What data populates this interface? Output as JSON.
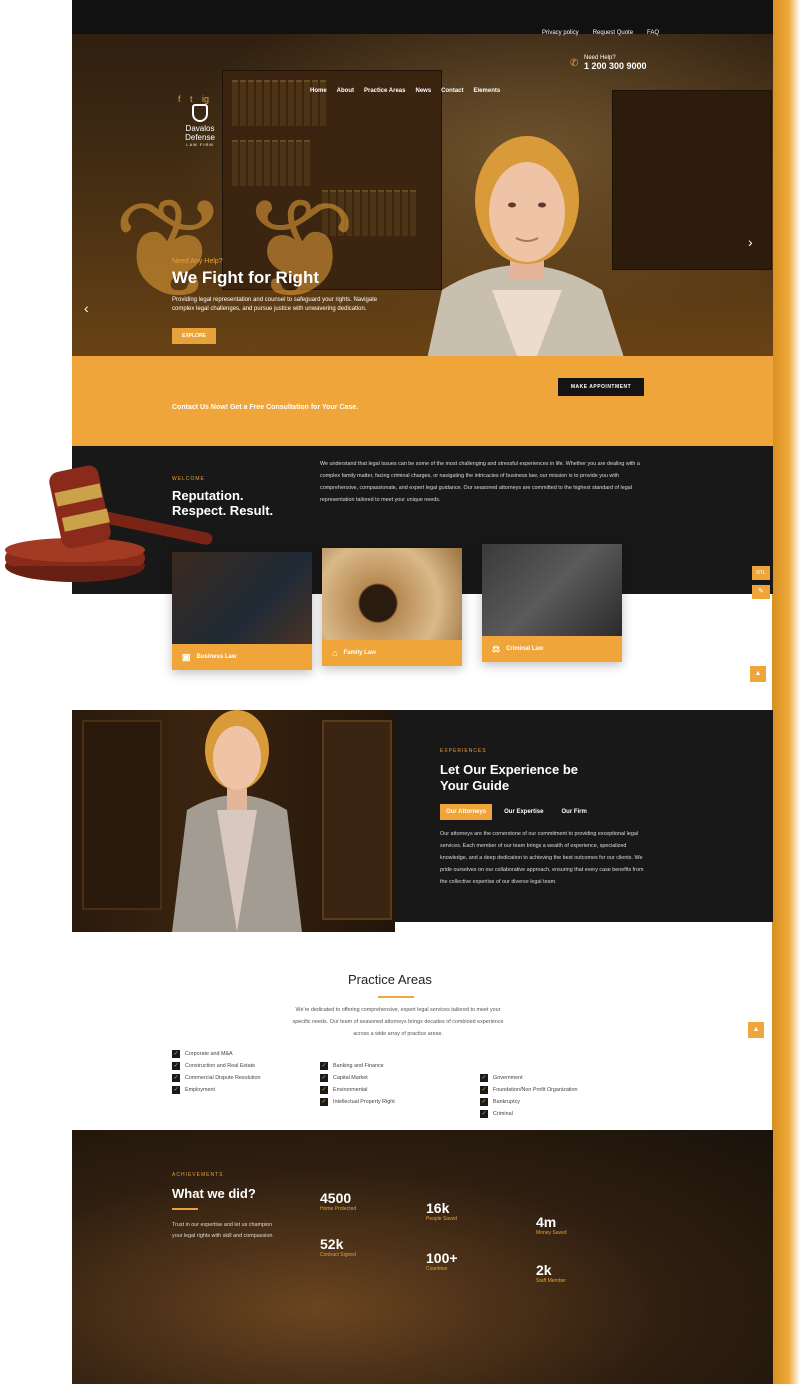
{
  "colors": {
    "accent": "#f0a53a",
    "dark": "#181818"
  },
  "topbar": {
    "links": [
      "Privacy policy",
      "Request Quote",
      "FAQ"
    ],
    "phone_label": "Need Help?",
    "phone_number": "1 200 300 9000"
  },
  "brand": {
    "name": "Davalos Defense",
    "tagline": "LAW FIRM"
  },
  "social": [
    "f",
    "t",
    "ig"
  ],
  "nav": [
    "Home",
    "About",
    "Practice Areas",
    "News",
    "Contact",
    "Elements"
  ],
  "hero": {
    "eyebrow": "Need Any Help?",
    "title": "We Fight for Right",
    "text": "Providing legal representation and counsel to safeguard your rights. Navigate complex legal challenges, and pursue justice with unwavering dedication.",
    "button": "EXPLORE"
  },
  "cta": {
    "text": "Contact Us Now! Get a Free Consultation for Your Case.",
    "button": "MAKE APPOINTMENT"
  },
  "welcome": {
    "eyebrow": "WELCOME",
    "title": "Reputation. Respect. Result.",
    "text": "We understand that legal issues can be some of the most challenging and stressful experiences in life. Whether you are dealing with a complex family matter, facing criminal charges, or navigating the intricacies of business law, our mission is to provide you with comprehensive, compassionate, and expert legal guidance. Our seasoned attorneys are committed to the highest standard of legal representation tailored to meet your unique needs."
  },
  "cards": [
    {
      "label": "Business Law",
      "icon": "briefcase-icon"
    },
    {
      "label": "Family Law",
      "icon": "home-icon"
    },
    {
      "label": "Criminal Law",
      "icon": "gavel-icon"
    }
  ],
  "side": {
    "rtl": "RTL"
  },
  "experience": {
    "eyebrow": "EXPERIENCES",
    "title": "Let Our Experience be Your Guide",
    "tabs": [
      "Our Attorneys",
      "Our Expertise",
      "Our Firm"
    ],
    "text": "Our attorneys are the cornerstone of our commitment to providing exceptional legal services. Each member of our team brings a wealth of experience, specialized knowledge, and a deep dedication to achieving the best outcomes for our clients. We pride ourselves on our collaborative approach, ensuring that every case benefits from the collective expertise of our diverse legal team."
  },
  "practice": {
    "title": "Practice Areas",
    "text": "We're dedicated to offering comprehensive, expert legal services tailored to meet your specific needs. Our team of seasoned attorneys brings decades of combined experience across a wide array of practice areas.",
    "columns": [
      [
        "Corporate and M&A",
        "Construction and Real Estate",
        "Commercial Dispute Resolution",
        "Employment"
      ],
      [
        "Banking and Finance",
        "Capital Market",
        "Environmental",
        "Intellectual Property Right"
      ],
      [
        "Government",
        "Foundation/Non Profit Organization",
        "Bankruptcy",
        "Criminal"
      ]
    ]
  },
  "stats": {
    "eyebrow": "ACHIEVEMENTS",
    "title": "What we did?",
    "text": "Trust in our expertise and let us champion your legal rights with skill and compassion.",
    "items": [
      {
        "value": "4500",
        "label": "Home Protected"
      },
      {
        "value": "16k",
        "label": "People Saved"
      },
      {
        "value": "4m",
        "label": "Money Saved"
      },
      {
        "value": "52k",
        "label": "Contract Signed"
      },
      {
        "value": "100+",
        "label": "Countries"
      },
      {
        "value": "2k",
        "label": "Staff Member"
      }
    ]
  }
}
